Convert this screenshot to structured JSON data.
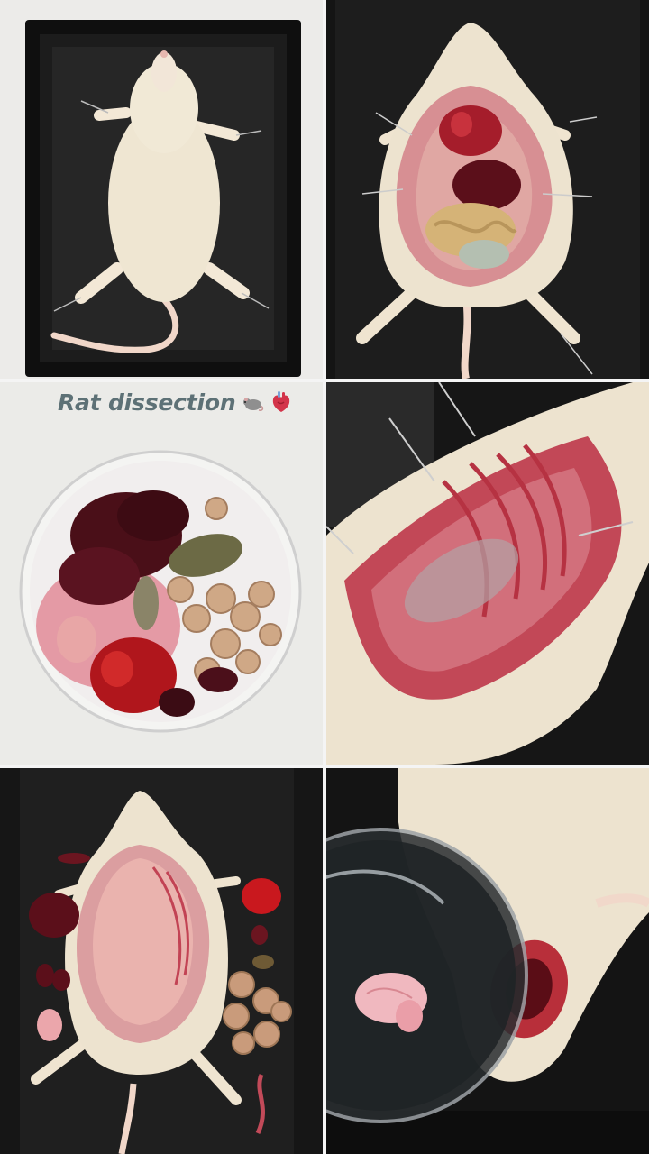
{
  "story": {
    "caption": "Rat dissection",
    "emojis": [
      "rat-emoji",
      "anatomical-heart-emoji"
    ]
  },
  "photos": [
    {
      "name": "intact-rat-in-tray"
    },
    {
      "name": "opened-abdomen"
    },
    {
      "name": "organs-in-petri-dish"
    },
    {
      "name": "thoracic-cavity-closeup"
    },
    {
      "name": "organs-removed-beside-body"
    },
    {
      "name": "brain-in-dish"
    }
  ],
  "colors": {
    "tray": "#141414",
    "fur": "#efe6d2",
    "tissue": "#c7404f",
    "organ_dark": "#5b0f1a",
    "caption": "#5d7176"
  }
}
